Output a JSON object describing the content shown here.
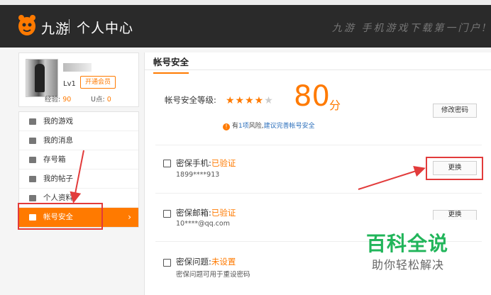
{
  "header": {
    "logo_text": "九游",
    "title": "个人中心",
    "slogan": "九游 手机游戏下载第一门户!"
  },
  "profile": {
    "level": "Lv1",
    "vip_button": "开通会员",
    "exp_label": "经验:",
    "exp_value": "90",
    "upoint_label": "U点:",
    "upoint_value": "0"
  },
  "menu": {
    "items": [
      {
        "label": "我的游戏",
        "icon": "user-icon"
      },
      {
        "label": "我的消息",
        "icon": "mail-icon"
      },
      {
        "label": "存号箱",
        "icon": "box-icon"
      },
      {
        "label": "我的帖子",
        "icon": "post-icon"
      },
      {
        "label": "个人资料",
        "icon": "profile-icon"
      },
      {
        "label": "帐号安全",
        "icon": "lock-icon",
        "active": true
      }
    ],
    "active_chevron": "›"
  },
  "main": {
    "tab": "帐号安全",
    "security_label": "帐号安全等级:",
    "stars_on": "★★★★",
    "stars_off": "★",
    "rating_stars": 4,
    "rating_max": 5,
    "score": "80",
    "score_unit": "分",
    "change_password": "修改密码",
    "risk_prefix": "有",
    "risk_count": "1项",
    "risk_middle": "风险,",
    "risk_link": "建议完善帐号安全",
    "risk_icon_glyph": "!",
    "rows": [
      {
        "title": "密保手机:",
        "status": "已验证",
        "sub": "1899****913",
        "button": "更换",
        "icon": "phone-icon"
      },
      {
        "title": "密保邮箱:",
        "status": "已验证",
        "sub": "10****@qq.com",
        "button": "更换",
        "icon": "email-icon"
      },
      {
        "title": "密保问题:",
        "status": "未设置",
        "sub": "密保问题可用于重设密码",
        "button": "",
        "icon": "question-icon"
      }
    ]
  },
  "watermark": {
    "title": "百科全说",
    "sub": "助你轻松解决"
  },
  "colors": {
    "accent": "#ff7a00",
    "header_bg": "#2a2a2a",
    "link": "#2a6ebb",
    "annotation_red": "#e23b3b",
    "watermark_green": "#21b55a"
  }
}
